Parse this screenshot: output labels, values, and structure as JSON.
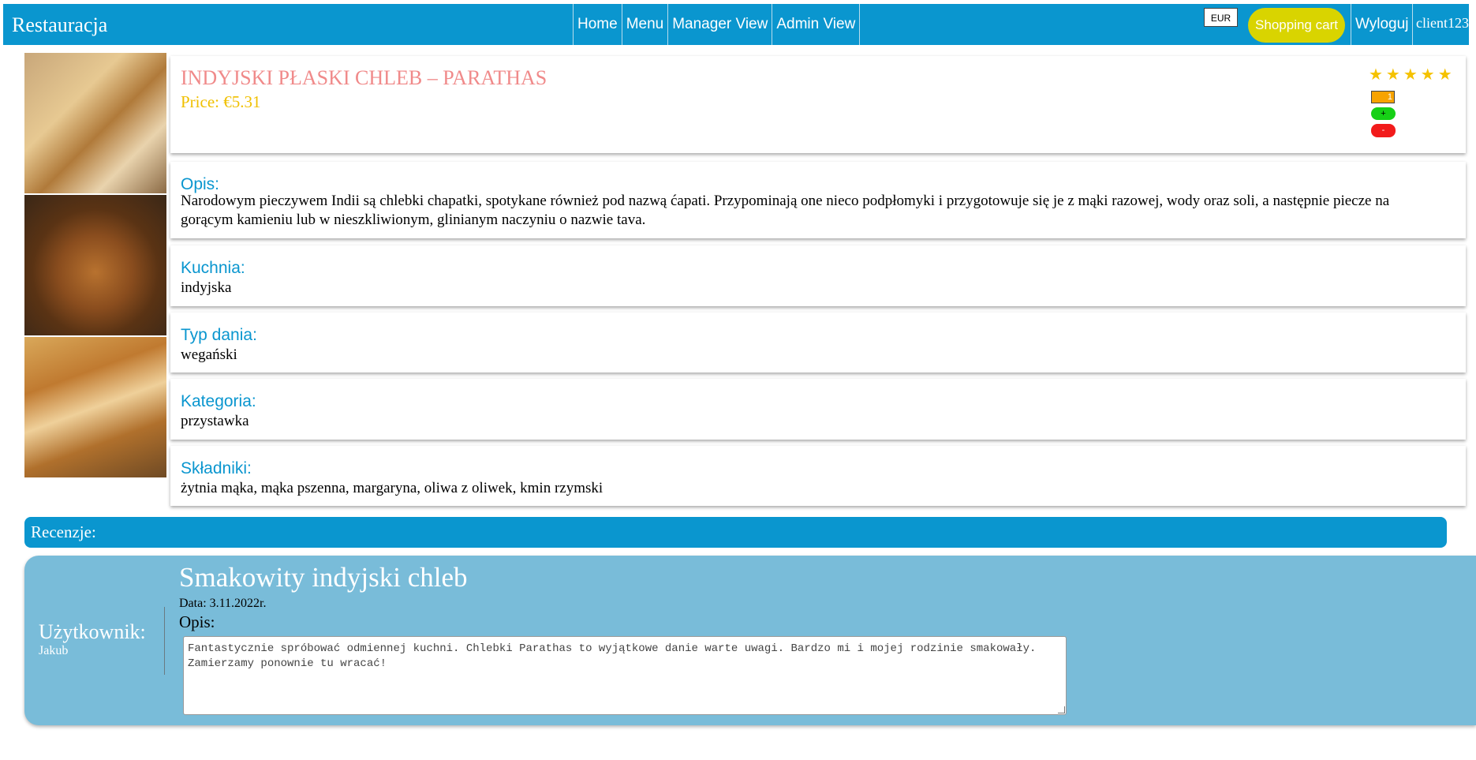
{
  "navbar": {
    "brand": "Restauracja",
    "links": [
      "Home",
      "Menu",
      "Manager View",
      "Admin View"
    ],
    "currency": "EUR",
    "cart": "Shopping cart",
    "logout": "Wyloguj",
    "user": "client123"
  },
  "dish": {
    "title": "INDYJSKI PŁASKI CHLEB – PARATHAS",
    "price": "Price: €5.31",
    "stars": "★★★★★",
    "quantity": "1",
    "plus": "+",
    "minus": "-"
  },
  "details": {
    "opis_label": "Opis:",
    "opis": "Narodowym pieczywem Indii są chlebki chapatki, spotykane również pod nazwą ćapati. Przypominają one nieco podpłomyki i przygotowuje się je z mąki razowej, wody oraz soli, a następnie piecze na gorącym kamieniu lub w nieszkliwionym, glinianym naczyniu o nazwie tava.",
    "kuchnia_label": "Kuchnia:",
    "kuchnia": "indyjska",
    "typ_label": "Typ dania:",
    "typ": "wegański",
    "kategoria_label": "Kategoria:",
    "kategoria": "przystawka",
    "skladniki_label": "Składniki:",
    "skladniki": "żytnia mąka, mąka pszenna, margaryna, oliwa z oliwek, kmin rzymski"
  },
  "reviews": {
    "header": "Recenzje:",
    "items": [
      {
        "user_label": "Użytkownik:",
        "user": "Jakub",
        "title": "Smakowity indyjski chleb",
        "date": "Data: 3.11.2022r.",
        "opis_label": "Opis:",
        "text": "Fantastycznie spróbować odmiennej kuchni. Chlebki Parathas to wyjątkowe danie warte uwagi. Bardzo mi i mojej rodzinie smakowały. Zamierzamy ponownie tu wracać!"
      }
    ]
  },
  "colors": {
    "primary": "#0a96cf",
    "review_bg": "#79bcd9",
    "title": "#f08a8a",
    "price": "#f0c000",
    "cart": "#d9d400"
  }
}
